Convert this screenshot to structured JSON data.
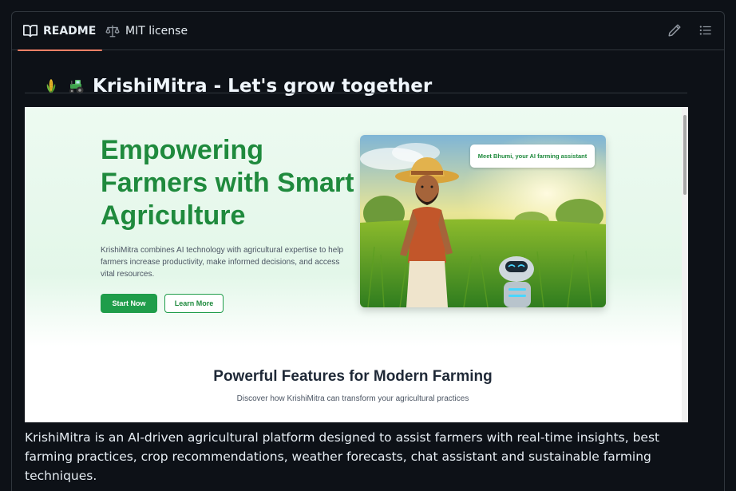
{
  "tabs": {
    "readme": "README",
    "license": "MIT license"
  },
  "icons": {
    "readme": "book-icon",
    "license": "scale-icon",
    "edit": "pencil-icon",
    "outline": "list-icon"
  },
  "readme": {
    "title": "KrishiMitra - Let's grow together",
    "title_emojis": [
      "corn-icon",
      "tractor-icon"
    ],
    "description": "KrishiMitra is an AI-driven agricultural platform designed to assist farmers with real-time insights, best farming practices, crop recommendations, weather forecasts, chat assistant and sustainable farming techniques."
  },
  "screenshot": {
    "hero_heading": "Empowering Farmers with Smart Agriculture",
    "hero_text": "KrishiMitra combines AI technology with agricultural expertise to help farmers increase productivity, make informed decisions, and access vital resources.",
    "start_button": "Start Now",
    "learn_button": "Learn More",
    "bubble_text": "Meet Bhumi, your AI farming assistant",
    "features_heading": "Powerful Features for Modern Farming",
    "features_sub": "Discover how KrishiMitra can transform your agricultural practices"
  },
  "colors": {
    "background": "#0d1117",
    "border": "#30363d",
    "active_tab": "#f78166",
    "brand_green": "#1f9d4a"
  }
}
